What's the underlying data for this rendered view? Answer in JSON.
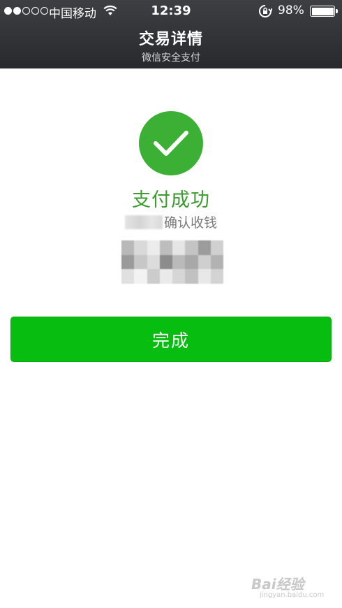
{
  "status_bar": {
    "carrier": "中国移动",
    "time": "12:39",
    "battery_percent": "98%",
    "signal_strength": 2,
    "battery_level": 0.98
  },
  "nav": {
    "title": "交易详情",
    "subtitle": "微信安全支付"
  },
  "result": {
    "icon": "check-circle-icon",
    "title": "支付成功",
    "confirm_text": "确认收钱"
  },
  "done_button": {
    "label": "完成"
  },
  "watermark": {
    "text": "Bai经验",
    "sub": "jingyan.baidu.com"
  },
  "colors": {
    "header_bg": "#2f3134",
    "success_green": "#3cb034",
    "success_text": "#3a9c2f",
    "button_green": "#07bd0f"
  }
}
